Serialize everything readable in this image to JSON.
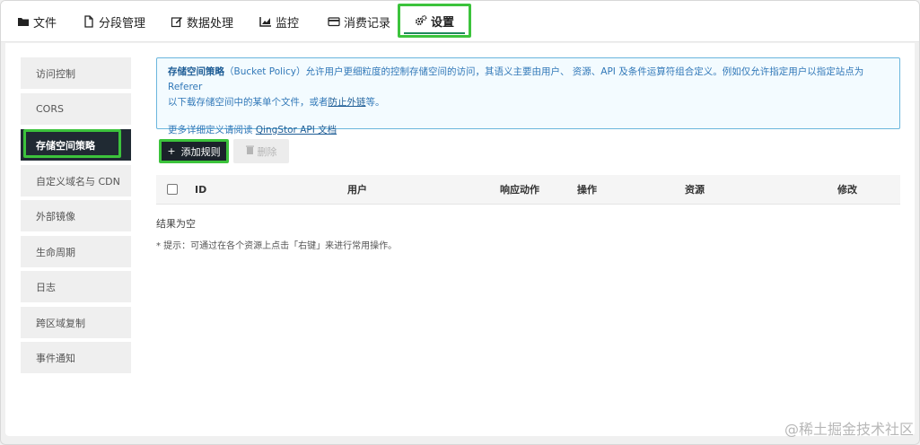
{
  "tabs": [
    {
      "label": "文件",
      "icon": "folder-icon"
    },
    {
      "label": "分段管理",
      "icon": "document-icon"
    },
    {
      "label": "数据处理",
      "icon": "edit-icon"
    },
    {
      "label": "监控",
      "icon": "chart-icon"
    },
    {
      "label": "消费记录",
      "icon": "card-icon"
    },
    {
      "label": "设置",
      "icon": "gears-icon",
      "active": true
    }
  ],
  "sidebar": {
    "items": [
      {
        "label": "访问控制"
      },
      {
        "label": "CORS"
      },
      {
        "label": "存储空间策略",
        "active": true
      },
      {
        "label": "自定义域名与 CDN"
      },
      {
        "label": "外部镜像"
      },
      {
        "label": "生命周期"
      },
      {
        "label": "日志"
      },
      {
        "label": "跨区域复制"
      },
      {
        "label": "事件通知"
      }
    ]
  },
  "info": {
    "title": "存储空间策略",
    "line1_rest": "（Bucket Policy）允许用户更细粒度的控制存储空间的访问，其语义主要由用户、 资源、API 及条件运算符组合定义。例如仅允许指定用户以指定站点为 Referer",
    "line2_a": "以下载存储空间中的某单个文件，或者",
    "line2_link": "防止外链",
    "line2_b": "等。",
    "line3_a": "更多详细定义请阅读 ",
    "line3_link": "QingStor API 文档"
  },
  "toolbar": {
    "add_label": "添加规则",
    "delete_label": "删除"
  },
  "table": {
    "columns": [
      "ID",
      "用户",
      "响应动作",
      "操作",
      "资源",
      "修改"
    ],
    "empty_text": "结果为空"
  },
  "tip": "* 提示：可通过在各个资源上点击「右键」来进行常用操作。",
  "watermark": "@稀土掘金技术社区",
  "colors": {
    "highlight": "#3cc33c",
    "dark": "#202a33",
    "info_border": "#6bb6dd",
    "info_text": "#3178b8"
  }
}
